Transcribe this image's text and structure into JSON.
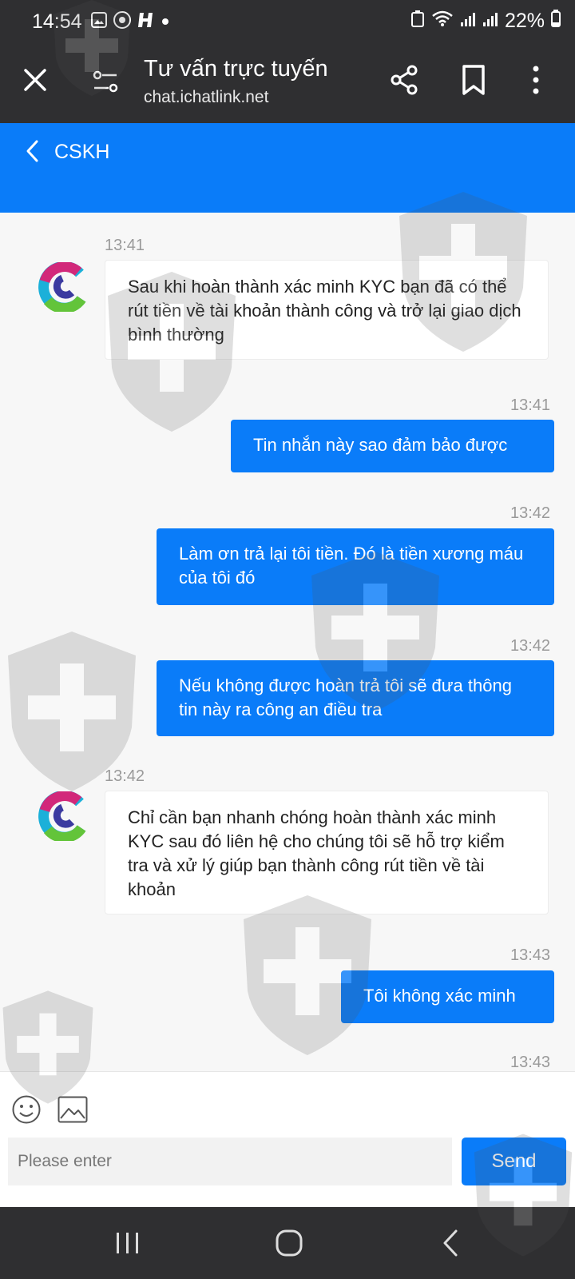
{
  "status_bar": {
    "time": "14:54",
    "battery": "22%",
    "icons": [
      "gallery-icon",
      "chrome-icon",
      "h-app-icon",
      "dot-icon",
      "recycle-icon",
      "wifi-icon",
      "signal-icon",
      "signal-icon",
      "battery-icon"
    ]
  },
  "browser_bar": {
    "title": "Tư vấn trực tuyến",
    "url": "chat.ichatlink.net"
  },
  "chat_header": {
    "title": "CSKH"
  },
  "messages": [
    {
      "side": "in",
      "time": "13:41",
      "text": "Sau khi hoàn thành xác minh KYC bạn đã có thể rút tiền về tài khoản thành công và trở lại giao dịch bình thường"
    },
    {
      "side": "out",
      "time": "13:41",
      "text": "Tin nhắn này sao đảm bảo được"
    },
    {
      "side": "out",
      "time": "13:42",
      "text": "Làm ơn trả lại tôi tiền. Đó là tiền xương máu của tôi đó"
    },
    {
      "side": "out",
      "time": "13:42",
      "text": "Nếu không được hoàn trả tôi sẽ đưa thông tin này ra công an điều tra"
    },
    {
      "side": "in",
      "time": "13:42",
      "text": "Chỉ cần bạn nhanh chóng hoàn thành xác minh KYC sau đó liên hệ cho chúng tôi sẽ hỗ trợ kiểm tra và xử lý giúp bạn thành công rút tiền về tài khoản"
    },
    {
      "side": "out",
      "time": "13:43",
      "text": "Tôi không xác minh"
    },
    {
      "side": "out",
      "time": "13:43",
      "text": ""
    }
  ],
  "composer": {
    "placeholder": "Please enter",
    "send_label": "Send"
  },
  "colors": {
    "accent": "#0a7cf9",
    "dark_bar": "#2f2f31"
  }
}
